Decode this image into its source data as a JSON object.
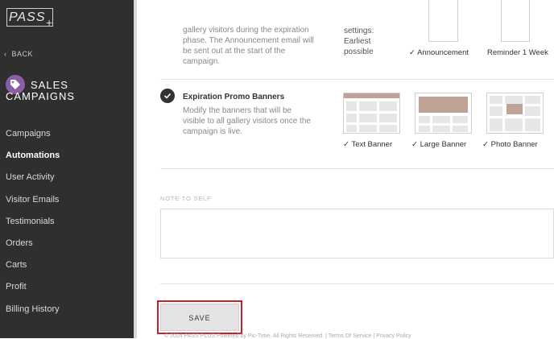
{
  "sidebar": {
    "logo": "PASS",
    "logo_plus": "+",
    "back_label": "BACK",
    "section_title_line1": "SALES",
    "section_title_line2": "CAMPAIGNS",
    "items": [
      {
        "label": "Campaigns",
        "active": false
      },
      {
        "label": "Automations",
        "active": true
      },
      {
        "label": "User Activity",
        "active": false
      },
      {
        "label": "Visitor Emails",
        "active": false
      },
      {
        "label": "Testimonials",
        "active": false
      },
      {
        "label": "Orders",
        "active": false
      },
      {
        "label": "Carts",
        "active": false
      },
      {
        "label": "Profit",
        "active": false
      },
      {
        "label": "Billing History",
        "active": false
      }
    ]
  },
  "phase_section": {
    "desc_lines": [
      "gallery visitors during the expiration",
      "phase. The Announcement email will",
      "be sent out at the start of the",
      "campaign."
    ],
    "settings_lines": [
      "settings:",
      "Earliest",
      "possible"
    ],
    "options": [
      {
        "label": "Announcement",
        "checked": true
      },
      {
        "label": "Reminder 1 Week",
        "checked": false
      }
    ]
  },
  "promo_section": {
    "title": "Expiration Promo Banners",
    "desc_lines": [
      "Modify the banners that will be",
      "visible to all gallery visitors once the",
      "campaign is live."
    ],
    "banners": [
      {
        "label": "Text Banner",
        "checked": true
      },
      {
        "label": "Large Banner",
        "checked": true
      },
      {
        "label": "Photo Banner",
        "checked": true
      }
    ]
  },
  "note": {
    "label": "NOTE TO SELF",
    "value": ""
  },
  "save_label": "SAVE",
  "footer": "© 2024 PASS PLUS Powered by Pic-Time. All Rights Reserved. | Terms Of Service | Privacy Policy",
  "colors": {
    "sidebar_bg": "#2f2f2f",
    "accent_purple": "#8b5fa6",
    "banner_tan": "#bfa396",
    "highlight_red": "#c8202a"
  }
}
